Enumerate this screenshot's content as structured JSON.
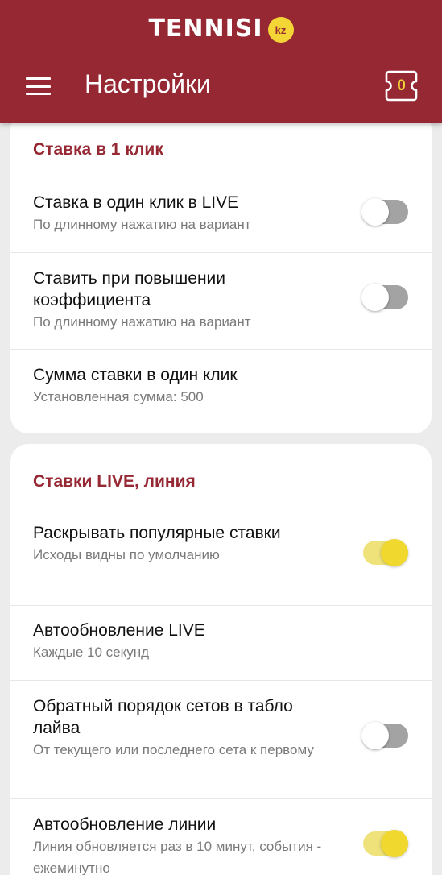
{
  "header": {
    "brand": "TENNISI",
    "brand_badge": "kz",
    "title": "Настройки",
    "coupon_count": "0",
    "icons": {
      "menu": "hamburger-menu-icon",
      "coupon": "coupon-ticket-icon"
    }
  },
  "colors": {
    "header_bg": "#962834",
    "accent_text": "#962834",
    "badge_yellow": "#f3d636",
    "toggle_on": "#f1d82e",
    "toggle_off": "#a3a3a3"
  },
  "sections": [
    {
      "title": "Ставка в 1 клик",
      "rows": [
        {
          "title": "Ставка в один клик в LIVE",
          "subtitle": "По длинному нажатию на вариант",
          "toggle": false
        },
        {
          "title": "Ставить при повышении коэффициента",
          "subtitle": "По длинному нажатию на вариант",
          "toggle": false
        },
        {
          "title": "Сумма ставки в один клик",
          "subtitle": "Установленная сумма: 500"
        }
      ]
    },
    {
      "title": "Ставки LIVE, линия",
      "rows": [
        {
          "title": "Раскрывать популярные ставки",
          "subtitle": "Исходы видны по умолчанию",
          "toggle": true
        },
        {
          "title": "Автообновление LIVE",
          "subtitle": "Каждые 10 секунд"
        },
        {
          "title": "Обратный порядок сетов в табло лайва",
          "subtitle": "От текущего или последнего сета к первому",
          "toggle": false
        },
        {
          "title": "Автообновление линии",
          "subtitle": "Линия обновляется раз в 10 минут, события - ежеминутно",
          "toggle": true
        }
      ]
    }
  ]
}
